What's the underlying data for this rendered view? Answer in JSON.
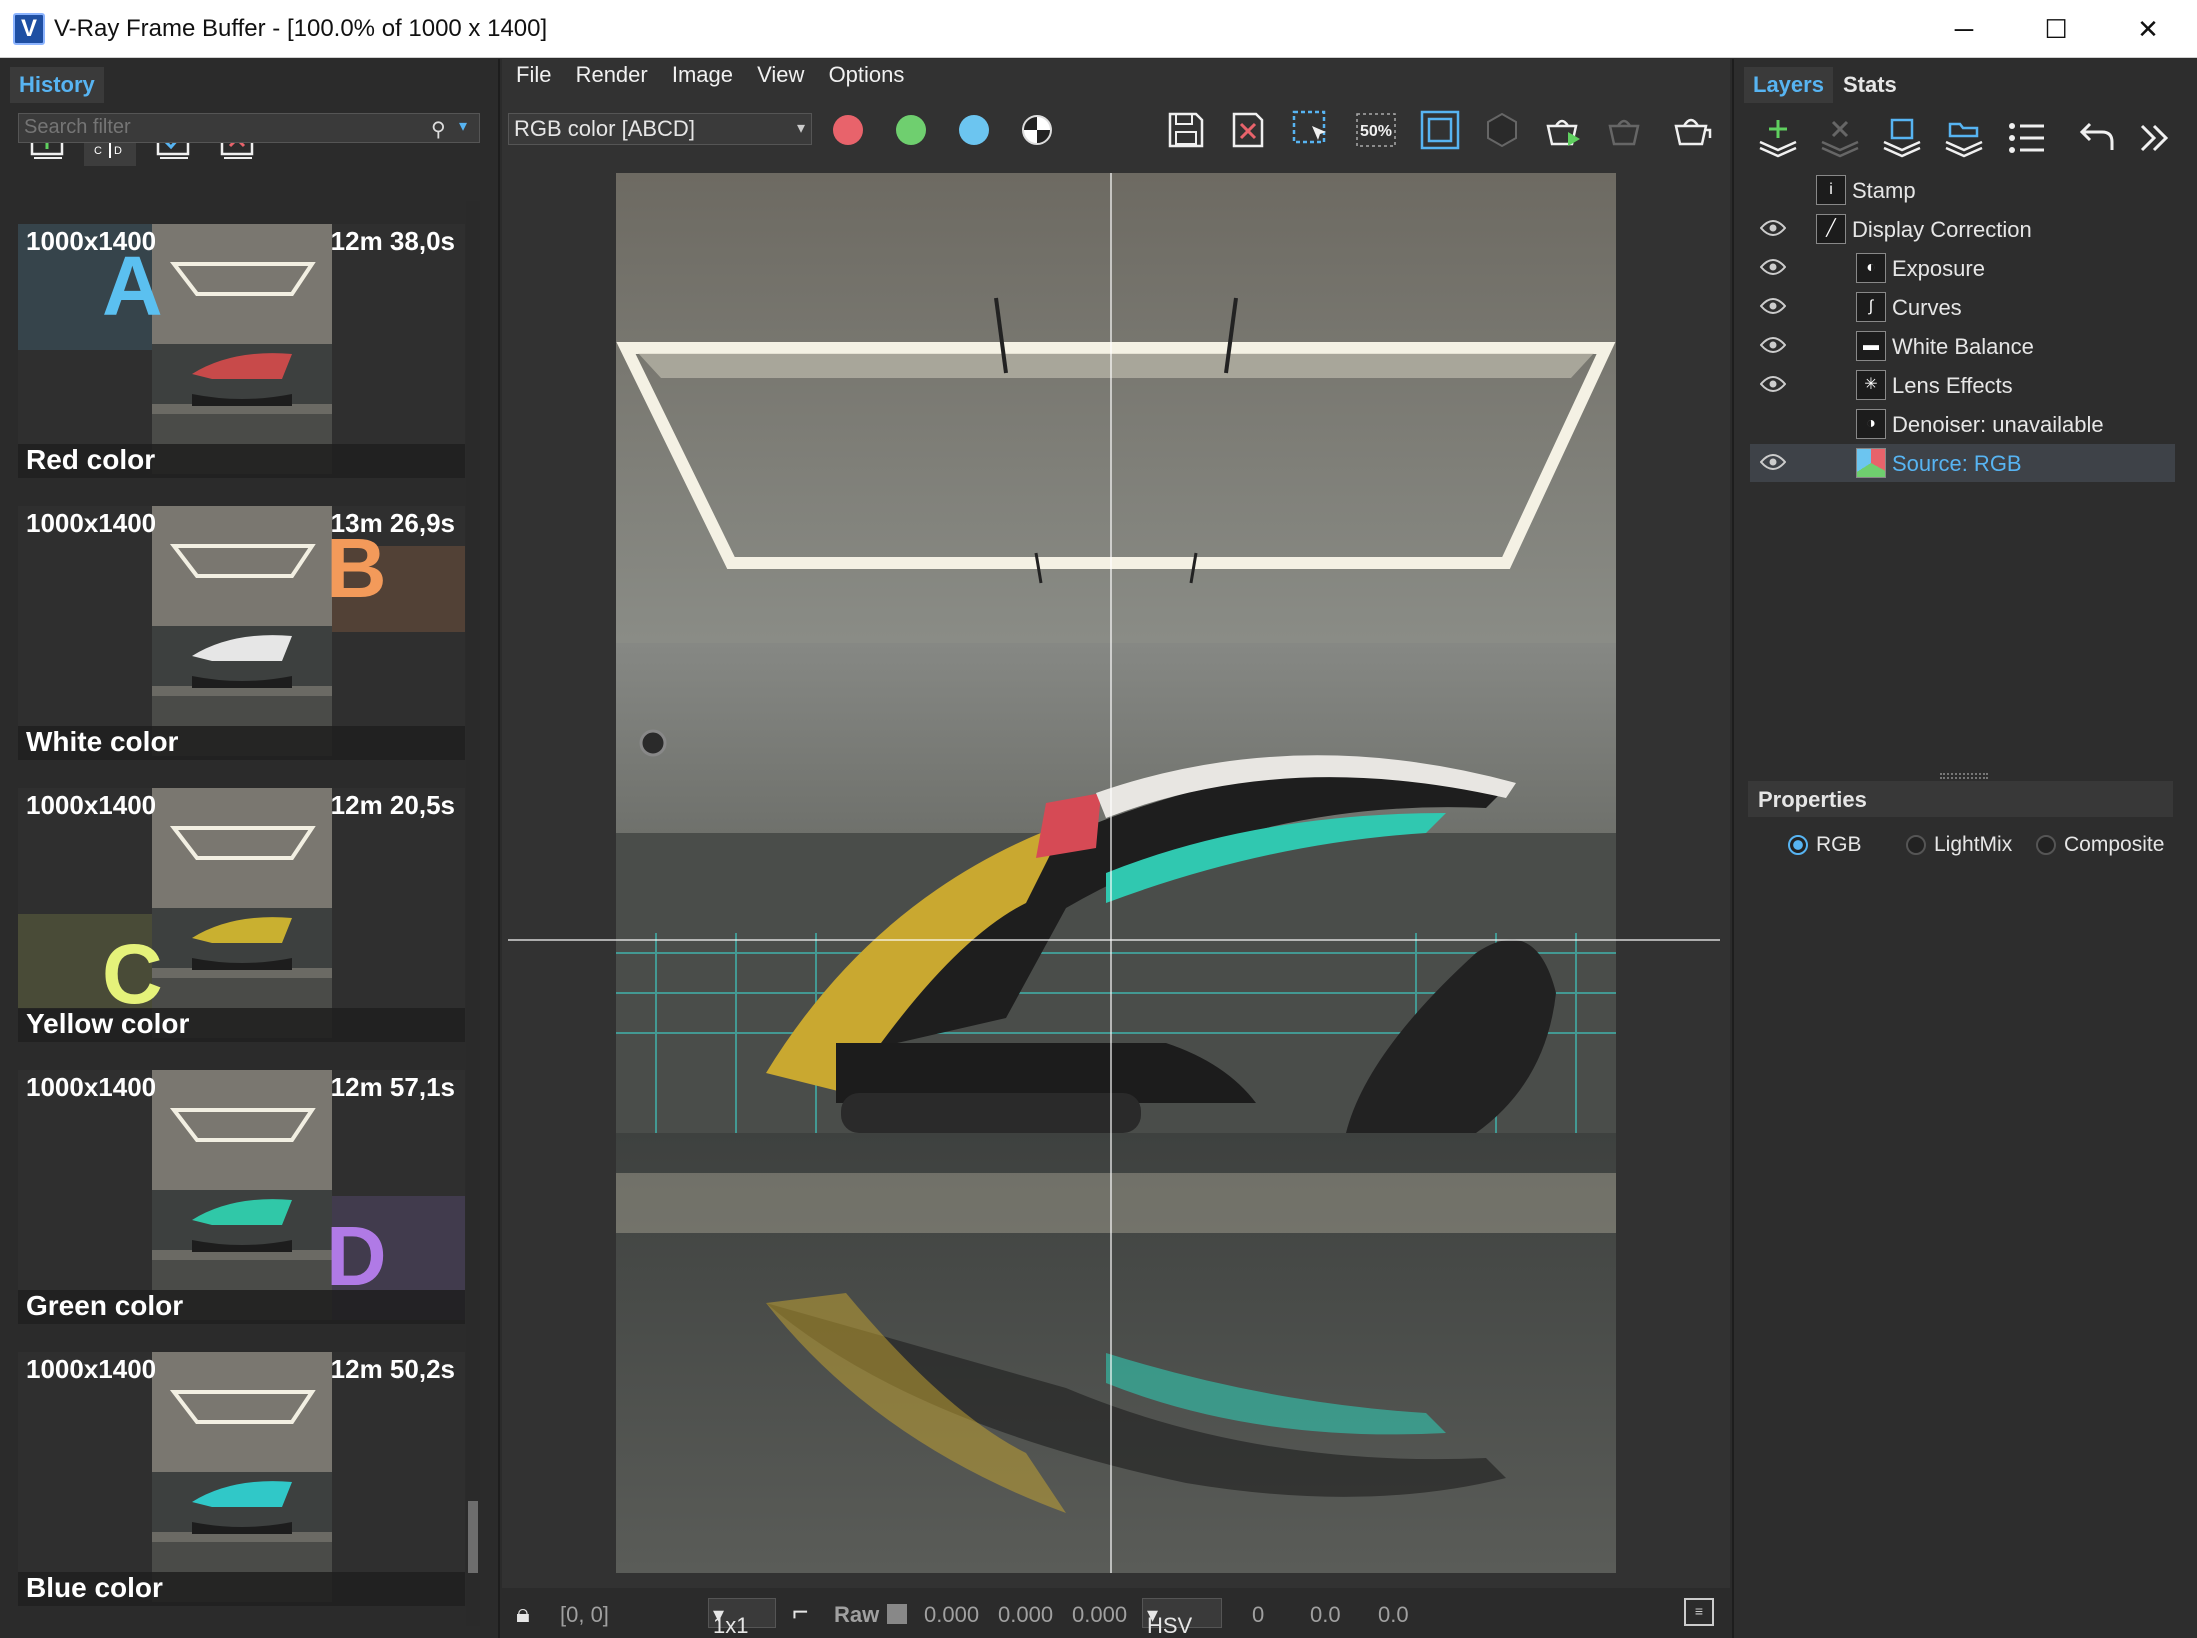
{
  "window": {
    "title": "V-Ray Frame Buffer - [100.0% of 1000 x 1400]",
    "minimize": "─",
    "maximize": "☐",
    "close": "✕"
  },
  "history": {
    "tab_label": "History",
    "search_placeholder": "Search filter",
    "items": [
      {
        "resolution": "1000x1400",
        "time": "12m 38,0s",
        "name": "Red color",
        "badge": "A",
        "badge_color": "#5bc0f0",
        "accent": "#c84a4a"
      },
      {
        "resolution": "1000x1400",
        "time": "13m 26,9s",
        "name": "White color",
        "badge": "B",
        "badge_color": "#f39a5a",
        "accent": "#e6e6e6"
      },
      {
        "resolution": "1000x1400",
        "time": "12m 20,5s",
        "name": "Yellow color",
        "badge": "C",
        "badge_color": "#e5f27a",
        "accent": "#c9b030"
      },
      {
        "resolution": "1000x1400",
        "time": "12m 57,1s",
        "name": "Green color",
        "badge": "D",
        "badge_color": "#b07ae6",
        "accent": "#30c8a8"
      },
      {
        "resolution": "1000x1400",
        "time": "12m 50,2s",
        "name": "Blue color",
        "badge": "",
        "badge_color": "",
        "accent": "#30c8c8"
      }
    ]
  },
  "menu": {
    "file": "File",
    "render": "Render",
    "image": "Image",
    "view": "View",
    "options": "Options"
  },
  "toolbar": {
    "channel_select": "RGB color [ABCD]",
    "zoom_label": "50%",
    "colors": {
      "red": "#e8636b",
      "green": "#6fcf6f",
      "blue": "#6cc5f0"
    }
  },
  "status": {
    "coords": "[0, 0]",
    "sample": "1x1",
    "raw_label": "Raw",
    "r": "0.000",
    "g": "0.000",
    "b": "0.000",
    "color_mode": "HSV",
    "h": "0",
    "s": "0.0",
    "v": "0.0"
  },
  "layers": {
    "tab_layers": "Layers",
    "tab_stats": "Stats",
    "items": [
      {
        "label": "Stamp",
        "icon": "i",
        "visible": false,
        "indent": false,
        "selected": false
      },
      {
        "label": "Display Correction",
        "icon": "╱",
        "visible": true,
        "indent": false,
        "selected": false
      },
      {
        "label": "Exposure",
        "icon": "◐",
        "visible": true,
        "indent": true,
        "selected": false
      },
      {
        "label": "Curves",
        "icon": "∫",
        "visible": true,
        "indent": true,
        "selected": false
      },
      {
        "label": "White Balance",
        "icon": "▬",
        "visible": true,
        "indent": true,
        "selected": false
      },
      {
        "label": "Lens Effects",
        "icon": "✳",
        "visible": true,
        "indent": true,
        "selected": false
      },
      {
        "label": "Denoiser: unavailable",
        "icon": "◑",
        "visible": false,
        "indent": true,
        "selected": false
      },
      {
        "label": "Source: RGB",
        "icon": "●",
        "visible": true,
        "indent": true,
        "selected": true
      }
    ]
  },
  "properties": {
    "header": "Properties",
    "options": [
      "RGB",
      "LightMix",
      "Composite"
    ],
    "selected": "RGB"
  }
}
